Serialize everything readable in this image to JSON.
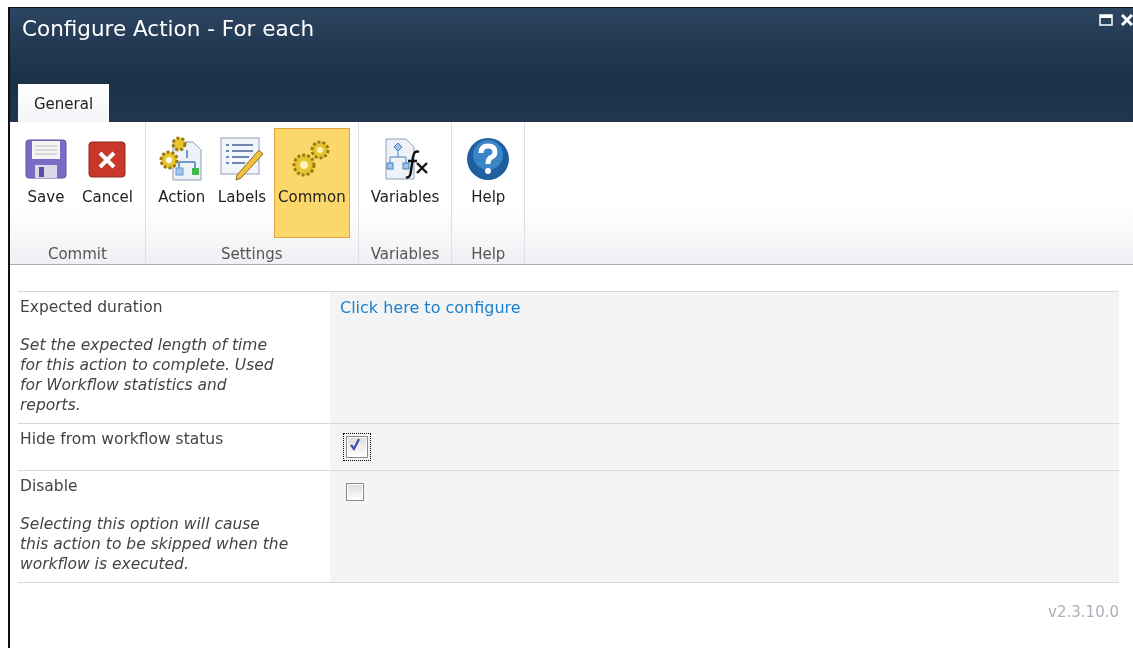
{
  "window": {
    "title": "Configure Action - For each"
  },
  "tabs": [
    {
      "label": "General",
      "selected": true
    }
  ],
  "ribbon": {
    "groups": [
      {
        "label": "Commit",
        "buttons": [
          {
            "label": "Save",
            "kind": "save",
            "selected": false
          },
          {
            "label": "Cancel",
            "kind": "cancel",
            "selected": false
          }
        ]
      },
      {
        "label": "Settings",
        "buttons": [
          {
            "label": "Action",
            "kind": "action",
            "selected": false
          },
          {
            "label": "Labels",
            "kind": "labels",
            "selected": false
          },
          {
            "label": "Common",
            "kind": "common",
            "selected": true
          }
        ]
      },
      {
        "label": "Variables",
        "buttons": [
          {
            "label": "Variables",
            "kind": "variables",
            "selected": false
          }
        ]
      },
      {
        "label": "Help",
        "buttons": [
          {
            "label": "Help",
            "kind": "help",
            "selected": false
          }
        ]
      }
    ]
  },
  "settings": [
    {
      "kind": "link",
      "label": "Expected duration",
      "description": "Set the expected length of time for this action to complete. Used for Workflow statistics and reports.",
      "link": "Click here to configure"
    },
    {
      "kind": "checkbox",
      "label": "Hide from workflow status",
      "checked": true,
      "focused": true
    },
    {
      "kind": "checkbox",
      "label": "Disable",
      "description": "Selecting this option will cause this action to be skipped when the workflow is executed.",
      "checked": false,
      "focused": false
    }
  ],
  "version": "v2.3.10.0"
}
